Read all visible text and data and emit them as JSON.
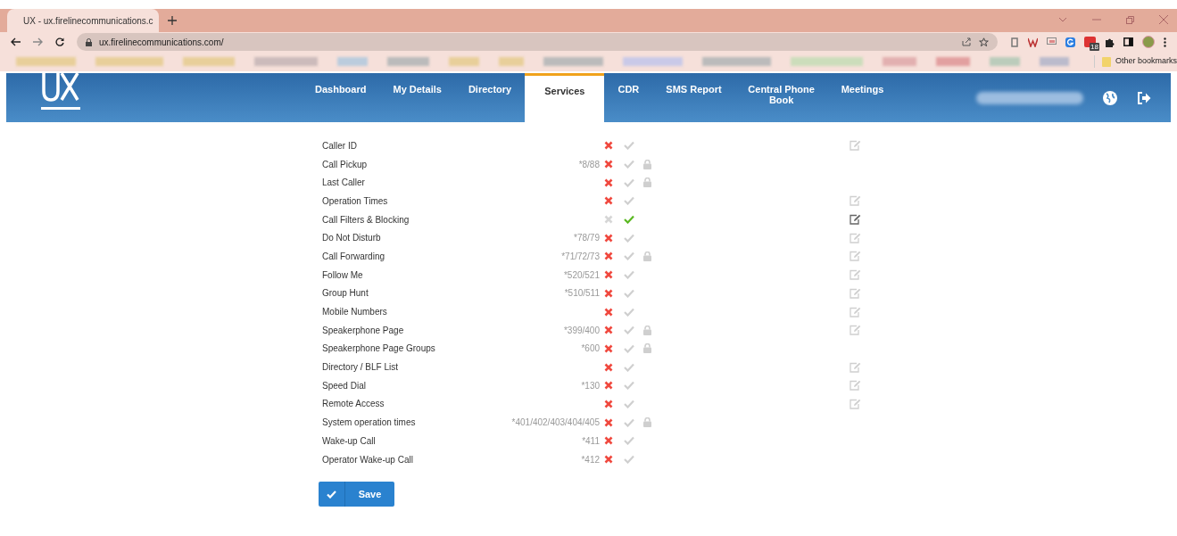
{
  "browser": {
    "tab_title": "UX - ux.firelinecommunications.c",
    "url": "ux.firelinecommunications.com/",
    "extension_badge": "18",
    "other_bookmarks": "Other bookmarks"
  },
  "nav": [
    {
      "label": "Dashboard",
      "selected": false
    },
    {
      "label": "My Details",
      "selected": false
    },
    {
      "label": "Directory",
      "selected": false
    },
    {
      "label": "Services",
      "selected": true
    },
    {
      "label": "CDR",
      "selected": false
    },
    {
      "label": "SMS Report",
      "selected": false
    },
    {
      "label": "Central Phone Book",
      "selected": false
    },
    {
      "label": "Meetings",
      "selected": false
    }
  ],
  "services": [
    {
      "name": "Caller ID",
      "enabled": false,
      "locked": false,
      "editable": true,
      "edit_active": false
    },
    {
      "name": "Call Pickup",
      "code": "*8/88",
      "enabled": false,
      "locked": true,
      "editable": false
    },
    {
      "name": "Last Caller",
      "enabled": false,
      "locked": true,
      "editable": false
    },
    {
      "name": "Operation Times",
      "enabled": false,
      "locked": false,
      "editable": true,
      "edit_active": false
    },
    {
      "name": "Call Filters & Blocking",
      "enabled": true,
      "locked": false,
      "editable": true,
      "edit_active": true
    },
    {
      "name": "Do Not Disturb",
      "code": "*78/79",
      "enabled": false,
      "locked": false,
      "editable": true,
      "edit_active": false
    },
    {
      "name": "Call Forwarding",
      "code": "*71/72/73",
      "enabled": false,
      "locked": true,
      "editable": true,
      "edit_active": false
    },
    {
      "name": "Follow Me",
      "code": "*520/521",
      "enabled": false,
      "locked": false,
      "editable": true,
      "edit_active": false
    },
    {
      "name": "Group Hunt",
      "code": "*510/511",
      "enabled": false,
      "locked": false,
      "editable": true,
      "edit_active": false
    },
    {
      "name": "Mobile Numbers",
      "enabled": false,
      "locked": false,
      "editable": true,
      "edit_active": false
    },
    {
      "name": "Speakerphone Page",
      "code": "*399/400",
      "enabled": false,
      "locked": true,
      "editable": true,
      "edit_active": false
    },
    {
      "name": "Speakerphone Page Groups",
      "code": "*600",
      "enabled": false,
      "locked": true,
      "editable": false
    },
    {
      "name": "Directory / BLF List",
      "enabled": false,
      "locked": false,
      "editable": true,
      "edit_active": false
    },
    {
      "name": "Speed Dial",
      "code": "*130",
      "enabled": false,
      "locked": false,
      "editable": true,
      "edit_active": false
    },
    {
      "name": "Remote Access",
      "enabled": false,
      "locked": false,
      "editable": true,
      "edit_active": false
    },
    {
      "name": "System operation times",
      "code": "*401/402/403/404/405",
      "enabled": false,
      "locked": true,
      "editable": false
    },
    {
      "name": "Wake-up Call",
      "code": "*411",
      "enabled": false,
      "locked": false,
      "editable": false
    },
    {
      "name": "Operator Wake-up Call",
      "code": "*412",
      "enabled": false,
      "locked": false,
      "editable": false
    }
  ],
  "save_button": "Save"
}
